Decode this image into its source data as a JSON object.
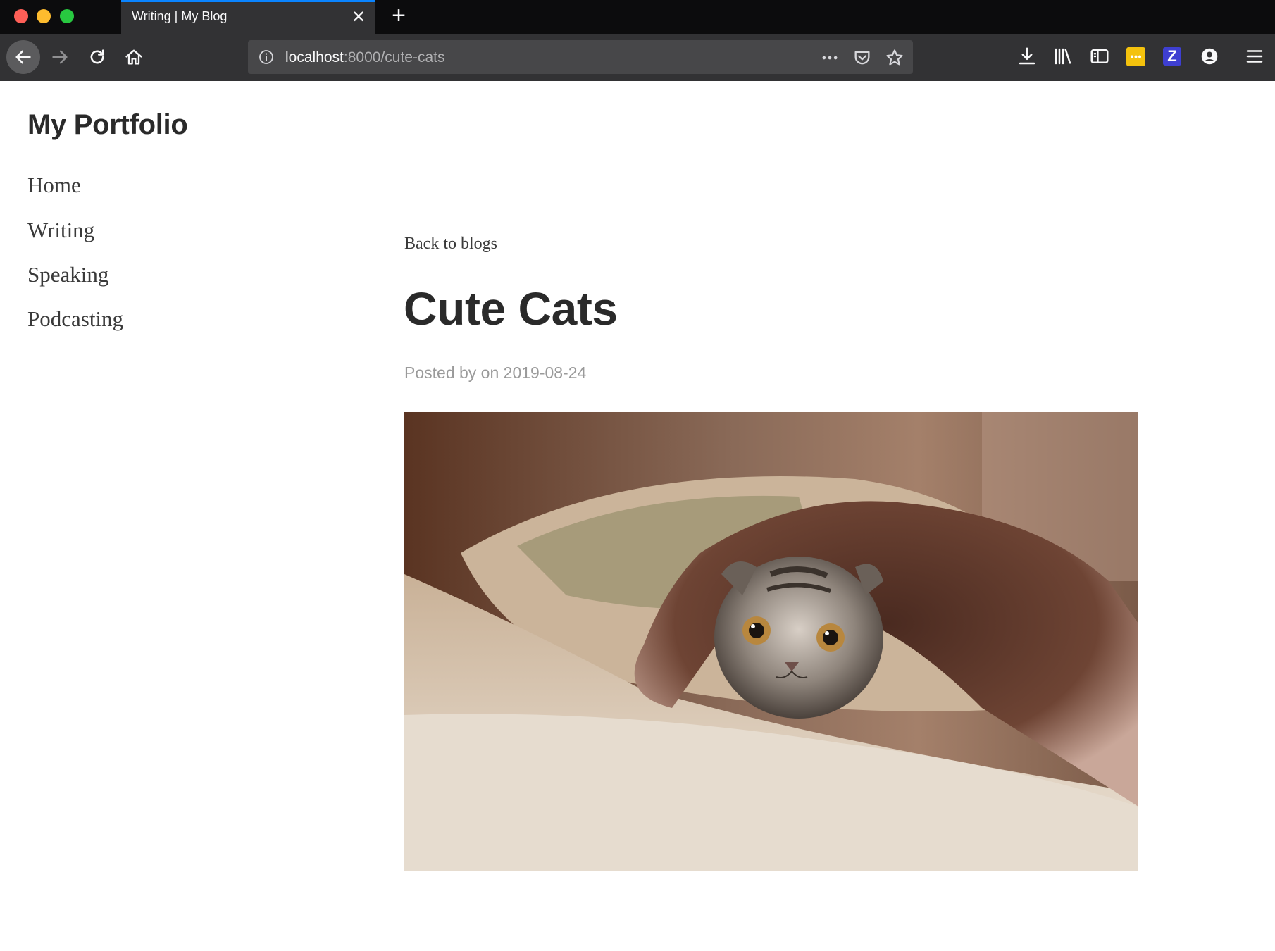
{
  "browser": {
    "tab_title": "Writing | My Blog",
    "url_host": "localhost",
    "url_rest": ":8000/cute-cats",
    "tab_close_glyph": "✕",
    "new_tab_glyph": "+",
    "ext_z_label": "Z"
  },
  "site": {
    "title": "My Portfolio",
    "nav": [
      "Home",
      "Writing",
      "Speaking",
      "Podcasting"
    ]
  },
  "post": {
    "back_link": "Back to blogs",
    "title": "Cute Cats",
    "meta": "Posted by on 2019-08-24",
    "image_alt": "kitten peeking from under a fluffy blanket on a pillow"
  },
  "colors": {
    "titlebar": "#0c0c0d",
    "toolbar": "#323234",
    "urlbar": "#474749",
    "tab_accent": "#0a84ff",
    "text_dark": "#2a2a2a",
    "meta_gray": "#9a9a9a"
  }
}
